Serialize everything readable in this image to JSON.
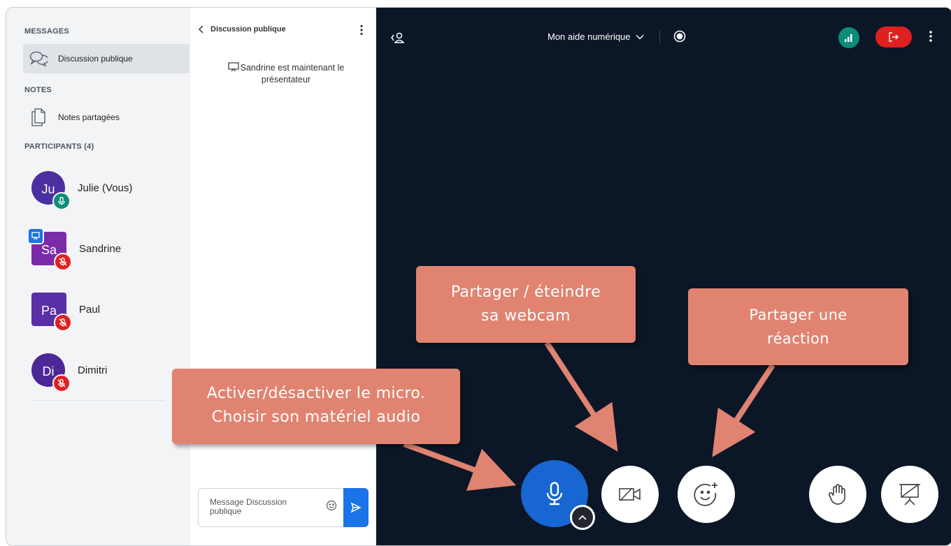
{
  "sidebar": {
    "messages_title": "MESSAGES",
    "public_chat_label": "Discussion publique",
    "notes_title": "NOTES",
    "shared_notes_label": "Notes partagées",
    "participants_title": "PARTICIPANTS (4)",
    "participants": [
      {
        "initials": "Ju",
        "name": "Julie (Vous)",
        "color": "#4a2fa0",
        "mic": "on",
        "presenter": false
      },
      {
        "initials": "Sa",
        "name": "Sandrine",
        "color": "#7b2aa8",
        "mic": "muted",
        "presenter": true
      },
      {
        "initials": "Pa",
        "name": "Paul",
        "color": "#5a2ea6",
        "mic": "muted",
        "presenter": false
      },
      {
        "initials": "Di",
        "name": "Dimitri",
        "color": "#4b2896",
        "mic": "muted",
        "presenter": false
      }
    ]
  },
  "chat": {
    "header_title": "Discussion publique",
    "system_message": "Sandrine est maintenant le présentateur",
    "input_placeholder": "Message Discussion publique"
  },
  "stage": {
    "meeting_title": "Mon aide numérique",
    "colors": {
      "background": "#0b1727",
      "mic_active": "#1766d1",
      "leave": "#e02020",
      "connection": "#0c8c7a"
    }
  },
  "annotations": {
    "mic_line1": "Activer/désactiver le micro.",
    "mic_line2": "Choisir son matériel audio",
    "webcam_line1": "Partager / éteindre",
    "webcam_line2": "sa webcam",
    "reaction_line1": "Partager une",
    "reaction_line2": "réaction",
    "color": "#e18371"
  }
}
